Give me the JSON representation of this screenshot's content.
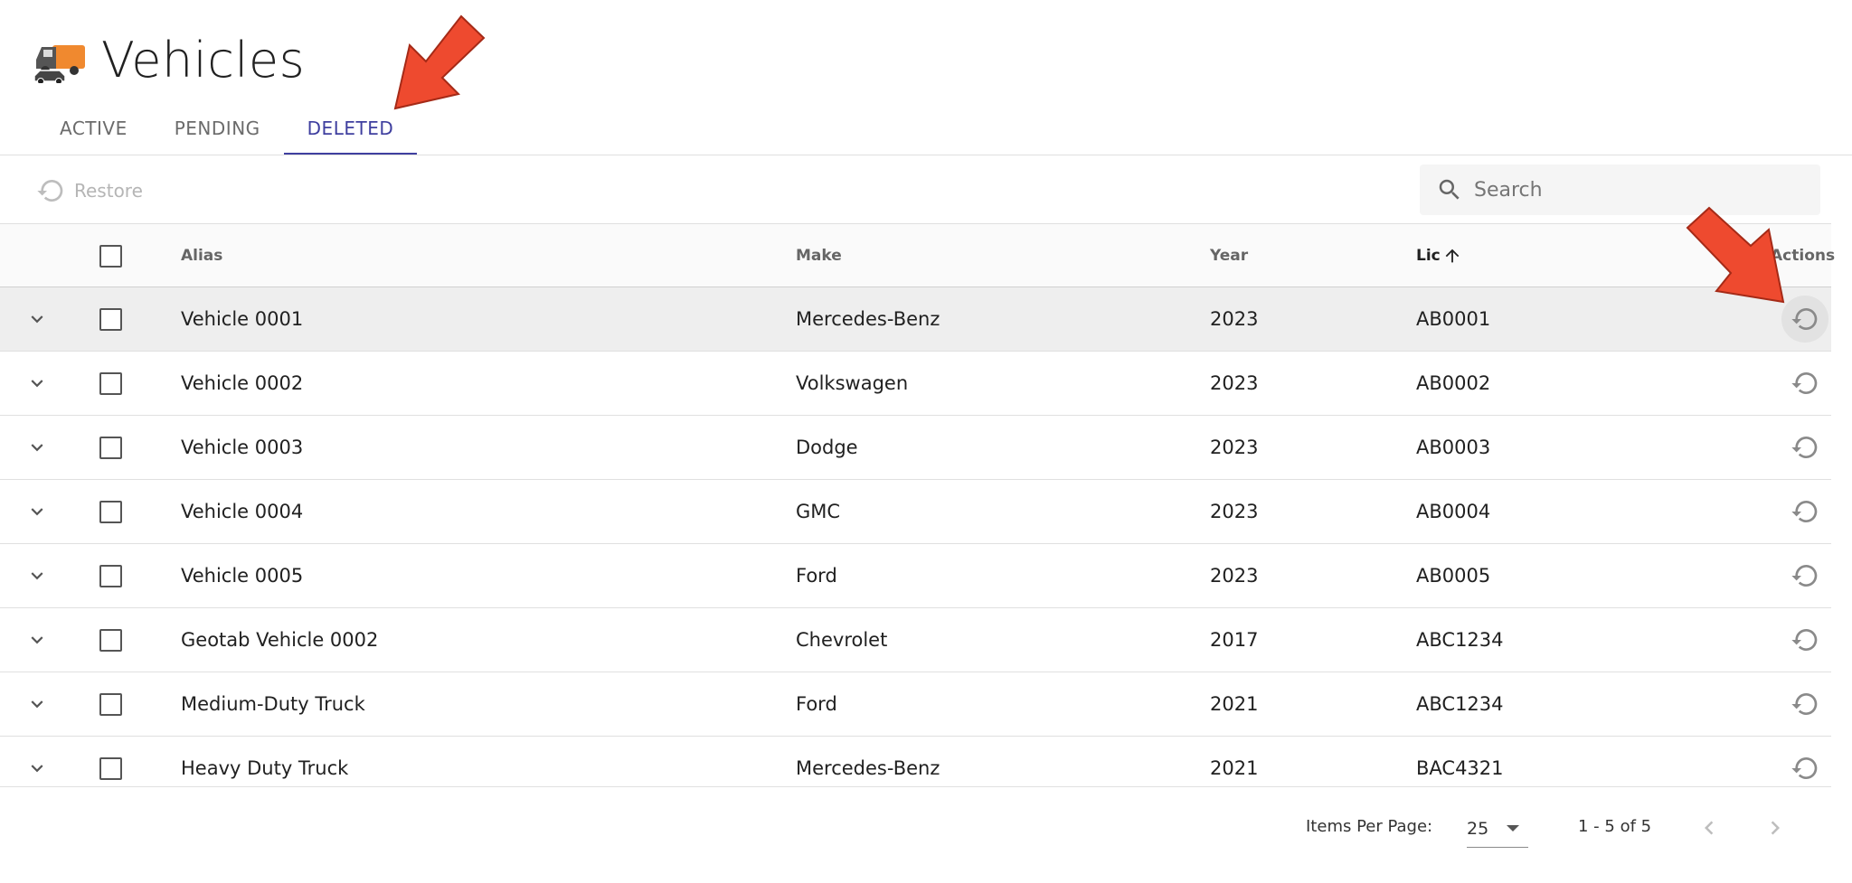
{
  "page": {
    "title": "Vehicles",
    "title_icon": "vehicles-icon"
  },
  "tabs": [
    {
      "label": "ACTIVE",
      "active": false
    },
    {
      "label": "PENDING",
      "active": false
    },
    {
      "label": "DELETED",
      "active": true
    }
  ],
  "toolbar": {
    "restore_label": "Restore",
    "restore_icon": "restore-icon",
    "search_placeholder": "Search",
    "search_icon": "search-icon"
  },
  "table": {
    "columns": {
      "alias": "Alias",
      "make": "Make",
      "year": "Year",
      "lic": "Lic",
      "actions": "Actions"
    },
    "sort": {
      "column": "Lic",
      "direction": "ascending",
      "icon": "arrow-up-icon"
    },
    "rows": [
      {
        "alias": "Vehicle 0001",
        "make": "Mercedes-Benz",
        "year": "2023",
        "lic": "AB0001"
      },
      {
        "alias": "Vehicle 0002",
        "make": "Volkswagen",
        "year": "2023",
        "lic": "AB0002"
      },
      {
        "alias": "Vehicle 0003",
        "make": "Dodge",
        "year": "2023",
        "lic": "AB0003"
      },
      {
        "alias": "Vehicle 0004",
        "make": "GMC",
        "year": "2023",
        "lic": "AB0004"
      },
      {
        "alias": "Vehicle 0005",
        "make": "Ford",
        "year": "2023",
        "lic": "AB0005"
      },
      {
        "alias": "Geotab Vehicle 0002",
        "make": "Chevrolet",
        "year": "2017",
        "lic": "ABC1234"
      },
      {
        "alias": "Medium-Duty Truck",
        "make": "Ford",
        "year": "2021",
        "lic": "ABC1234"
      },
      {
        "alias": "Heavy Duty Truck",
        "make": "Mercedes-Benz",
        "year": "2021",
        "lic": "BAC4321"
      }
    ]
  },
  "pagination": {
    "items_per_page_label": "Items Per Page:",
    "items_per_page_value": "25",
    "range_label": "1 - 5 of 5"
  },
  "colors": {
    "accent": "#3f3f9f",
    "annotation_arrow": "#e8412c",
    "hover_row": "#eeeeee"
  }
}
